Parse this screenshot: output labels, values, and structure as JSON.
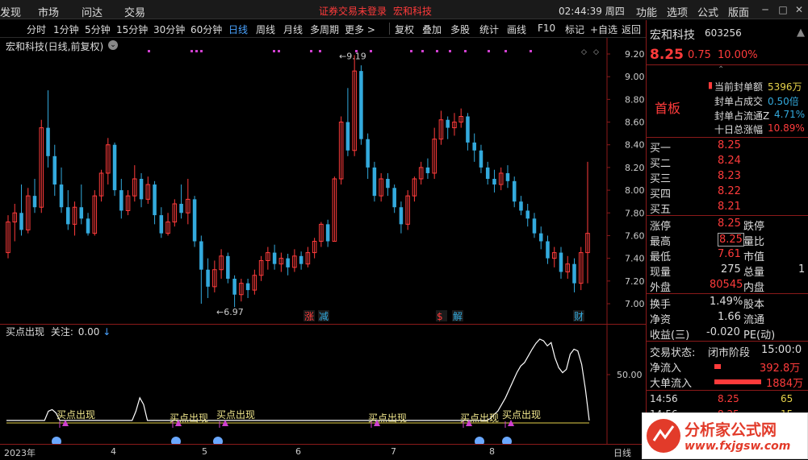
{
  "topbar": {
    "menu": [
      "发现",
      "市场",
      "问达",
      "交易"
    ],
    "notice": "证券交易未登录",
    "stock_name": "宏和科技",
    "clock": "02:44:39 周四",
    "right_menu": [
      "功能",
      "选项",
      "公式",
      "版面"
    ]
  },
  "toolbar": {
    "periods": [
      "分时",
      "1分钟",
      "5分钟",
      "15分钟",
      "30分钟",
      "60分钟",
      "日线",
      "周线",
      "月线",
      "多周期",
      "更多 >"
    ],
    "active_period": "日线",
    "tools": [
      "复权",
      "叠加",
      "多股",
      "统计",
      "画线",
      "F10",
      "标记",
      "+自选",
      "返回"
    ]
  },
  "chart": {
    "title": "宏和科技(日线,前复权)",
    "y_ticks": [
      "9.20",
      "9.00",
      "8.80",
      "8.60",
      "8.40",
      "8.20",
      "8.00",
      "7.80",
      "7.60",
      "7.40",
      "7.20",
      "7.00"
    ],
    "high_label": "9.19",
    "low_label": "6.97",
    "markers": [
      {
        "text": "涨",
        "color": "#ff3b3b"
      },
      {
        "text": "减",
        "color": "#3ad"
      },
      {
        "text": "$",
        "color": "#ff3b3b"
      },
      {
        "text": "解",
        "color": "#3ad"
      },
      {
        "text": "财",
        "color": "#3ad"
      }
    ],
    "candles": [
      [
        7.45,
        7.72,
        7.4,
        7.78
      ],
      [
        7.72,
        7.8,
        7.55,
        7.88
      ],
      [
        7.8,
        7.65,
        7.6,
        8.05
      ],
      [
        7.65,
        7.95,
        7.62,
        8.02
      ],
      [
        7.95,
        7.85,
        7.8,
        8.1
      ],
      [
        7.85,
        8.55,
        7.8,
        8.62
      ],
      [
        8.55,
        8.3,
        8.2,
        8.88
      ],
      [
        8.3,
        8.05,
        7.95,
        8.4
      ],
      [
        8.05,
        7.85,
        7.8,
        8.2
      ],
      [
        7.85,
        7.7,
        7.65,
        8.0
      ],
      [
        7.7,
        7.85,
        7.6,
        7.9
      ],
      [
        7.85,
        7.75,
        7.7,
        8.05
      ],
      [
        7.75,
        7.62,
        7.6,
        7.8
      ],
      [
        7.62,
        7.95,
        7.6,
        8.0
      ],
      [
        7.95,
        8.15,
        7.9,
        8.18
      ],
      [
        8.15,
        8.4,
        8.05,
        8.46
      ],
      [
        8.4,
        8.0,
        7.95,
        8.42
      ],
      [
        8.0,
        7.82,
        7.75,
        8.1
      ],
      [
        7.82,
        7.95,
        7.78,
        8.0
      ],
      [
        7.95,
        8.1,
        7.9,
        8.22
      ],
      [
        8.1,
        7.92,
        7.85,
        8.15
      ],
      [
        7.92,
        8.05,
        7.88,
        8.12
      ],
      [
        8.05,
        7.78,
        7.7,
        8.08
      ],
      [
        7.78,
        7.62,
        7.58,
        7.85
      ],
      [
        7.62,
        7.72,
        7.6,
        7.8
      ],
      [
        7.72,
        7.88,
        7.68,
        7.92
      ],
      [
        7.88,
        7.8,
        7.75,
        8.05
      ],
      [
        7.8,
        7.92,
        7.7,
        8.1
      ],
      [
        7.92,
        7.55,
        7.5,
        7.95
      ],
      [
        7.55,
        7.3,
        7.0,
        7.6
      ],
      [
        7.3,
        7.15,
        7.05,
        7.4
      ],
      [
        7.15,
        7.3,
        7.1,
        7.38
      ],
      [
        7.3,
        7.42,
        7.22,
        7.48
      ],
      [
        7.42,
        7.22,
        7.18,
        7.45
      ],
      [
        7.22,
        7.08,
        6.97,
        7.25
      ],
      [
        7.08,
        7.18,
        7.02,
        7.22
      ],
      [
        7.18,
        7.12,
        7.05,
        7.22
      ],
      [
        7.12,
        7.25,
        7.08,
        7.3
      ],
      [
        7.25,
        7.38,
        7.2,
        7.42
      ],
      [
        7.38,
        7.45,
        7.3,
        7.5
      ],
      [
        7.45,
        7.35,
        7.3,
        7.52
      ],
      [
        7.35,
        7.4,
        7.28,
        7.45
      ],
      [
        7.4,
        7.32,
        7.25,
        7.44
      ],
      [
        7.32,
        7.42,
        7.28,
        7.48
      ],
      [
        7.42,
        7.35,
        7.3,
        7.46
      ],
      [
        7.35,
        7.45,
        7.32,
        7.5
      ],
      [
        7.45,
        7.55,
        7.4,
        7.58
      ],
      [
        7.55,
        7.7,
        7.5,
        7.72
      ],
      [
        7.7,
        7.55,
        7.5,
        7.74
      ],
      [
        7.55,
        8.1,
        7.55,
        8.12
      ],
      [
        8.1,
        8.6,
        8.05,
        8.65
      ],
      [
        8.6,
        8.35,
        8.3,
        8.9
      ],
      [
        8.35,
        9.05,
        8.3,
        9.19
      ],
      [
        9.05,
        8.45,
        8.4,
        9.1
      ],
      [
        8.45,
        8.2,
        8.1,
        8.5
      ],
      [
        8.2,
        7.95,
        7.9,
        8.25
      ],
      [
        7.95,
        8.1,
        7.9,
        8.15
      ],
      [
        8.1,
        8.02,
        7.95,
        8.15
      ],
      [
        8.02,
        7.85,
        7.8,
        8.05
      ],
      [
        7.85,
        7.7,
        7.62,
        7.9
      ],
      [
        7.7,
        7.95,
        7.65,
        8.0
      ],
      [
        7.95,
        8.1,
        7.9,
        8.12
      ],
      [
        8.1,
        8.2,
        8.05,
        8.25
      ],
      [
        8.2,
        8.15,
        8.1,
        8.28
      ],
      [
        8.15,
        8.45,
        8.1,
        8.55
      ],
      [
        8.45,
        8.62,
        8.4,
        8.7
      ],
      [
        8.62,
        8.55,
        8.45,
        8.65
      ],
      [
        8.55,
        8.6,
        8.48,
        8.68
      ],
      [
        8.6,
        8.65,
        8.55,
        8.72
      ],
      [
        8.65,
        8.42,
        8.35,
        8.68
      ],
      [
        8.42,
        8.35,
        8.25,
        8.5
      ],
      [
        8.35,
        8.2,
        8.15,
        8.4
      ],
      [
        8.2,
        8.1,
        8.05,
        8.25
      ],
      [
        8.1,
        8.05,
        7.98,
        8.18
      ],
      [
        8.05,
        8.15,
        8.0,
        8.2
      ],
      [
        8.15,
        8.08,
        8.02,
        8.22
      ],
      [
        8.08,
        7.9,
        7.85,
        8.12
      ],
      [
        7.9,
        7.82,
        7.78,
        7.95
      ],
      [
        7.82,
        7.75,
        7.68,
        7.88
      ],
      [
        7.75,
        7.62,
        7.58,
        7.8
      ],
      [
        7.62,
        7.55,
        7.48,
        7.68
      ],
      [
        7.55,
        7.4,
        7.35,
        7.6
      ],
      [
        7.4,
        7.45,
        7.32,
        7.5
      ],
      [
        7.45,
        7.28,
        7.22,
        7.5
      ],
      [
        7.28,
        7.35,
        7.22,
        7.42
      ],
      [
        7.35,
        7.18,
        7.1,
        7.4
      ],
      [
        7.18,
        7.45,
        7.12,
        7.5
      ],
      [
        7.45,
        7.62,
        7.18,
        8.25
      ]
    ]
  },
  "indicator": {
    "title": "买点出现",
    "focus_label": "关注:",
    "focus_value": "0.00",
    "y_label": "50.00",
    "signal_text": "买点出现",
    "line": [
      3,
      3,
      3,
      3,
      3,
      3,
      3,
      3,
      3,
      3,
      3,
      14,
      16,
      12,
      3,
      3,
      3,
      3,
      3,
      3,
      3,
      3,
      3,
      3,
      3,
      3,
      3,
      3,
      3,
      3,
      3,
      3,
      3,
      3,
      14,
      30,
      22,
      3,
      3,
      3,
      3,
      3,
      3,
      3,
      3,
      3,
      3,
      3,
      3,
      3,
      3,
      3,
      3,
      3,
      3,
      3,
      3,
      3,
      3,
      3,
      3,
      3,
      3,
      3,
      3,
      3,
      3,
      3,
      3,
      3,
      3,
      3,
      3,
      3,
      3,
      3,
      3,
      3,
      3,
      3,
      3,
      3,
      3,
      3,
      3,
      3,
      3,
      3,
      3,
      3,
      3,
      3,
      3,
      3,
      3,
      3,
      3,
      3,
      3,
      3,
      3,
      3,
      3,
      3,
      3,
      3,
      3,
      3,
      3,
      3,
      3,
      3,
      3,
      3,
      3,
      3,
      3,
      3,
      3,
      3,
      3,
      3,
      3,
      3,
      3,
      3,
      3,
      5,
      10,
      14,
      22,
      30,
      40,
      50,
      60,
      68,
      72,
      80,
      88,
      95,
      100,
      98,
      92,
      96,
      78,
      66,
      60,
      64,
      82,
      88,
      86,
      70,
      40,
      3
    ]
  },
  "xaxis": {
    "labels": [
      "2023年",
      "4",
      "5",
      "6",
      "7",
      "8"
    ],
    "right_label": "日线"
  },
  "quote": {
    "name": "宏和科技",
    "code": "603256",
    "price": "8.25",
    "change": "0.75",
    "pct": "10.00%",
    "tag": "首板",
    "seal_label": "当前封单额",
    "seal_value": "5396万",
    "seal_deal_label": "封单占成交",
    "seal_deal_value": "0.50倍",
    "seal_float_label": "封单占流通Z",
    "seal_float_value": "4.71%",
    "ten_label": "十日总涨幅",
    "ten_value": "10.89%",
    "bids": [
      {
        "label": "买一",
        "price": "8.25"
      },
      {
        "label": "买二",
        "price": "8.24"
      },
      {
        "label": "买三",
        "price": "8.23"
      },
      {
        "label": "买四",
        "price": "8.22"
      },
      {
        "label": "买五",
        "price": "8.21"
      }
    ],
    "stats": [
      {
        "l1": "涨停",
        "v1": "8.25",
        "l2": "跌停",
        "v2": ""
      },
      {
        "l1": "最高",
        "v1": "8.25",
        "l2": "量比",
        "v2": ""
      },
      {
        "l1": "最低",
        "v1": "7.61",
        "l2": "市值",
        "v2": ""
      },
      {
        "l1": "现量",
        "v1": "275",
        "l2": "总量",
        "v2": "1"
      },
      {
        "l1": "外盘",
        "v1": "80545",
        "l2": "内盘",
        "v2": ""
      }
    ],
    "stats2": [
      {
        "l1": "换手",
        "v1": "1.49%",
        "l2": "股本",
        "v2": ""
      },
      {
        "l1": "净资",
        "v1": "1.66",
        "l2": "流通",
        "v2": ""
      },
      {
        "l1": "收益(三)",
        "v1": "-0.020",
        "l2": "PE(动)",
        "v2": ""
      }
    ],
    "trade_state_label": "交易状态:",
    "trade_state": "闭市阶段",
    "trade_time": "15:00:0",
    "net_in_label": "净流入",
    "net_in": "392.8万",
    "big_in_label": "大单流入",
    "big_in": "1884万",
    "ticks": [
      {
        "time": "14:56",
        "price": "8.25",
        "vol": "65"
      },
      {
        "time": "14:56",
        "price": "8.25",
        "vol": "15"
      }
    ]
  },
  "watermark": {
    "name": "分析家公式网",
    "url": "www.fxjgsw.com"
  }
}
